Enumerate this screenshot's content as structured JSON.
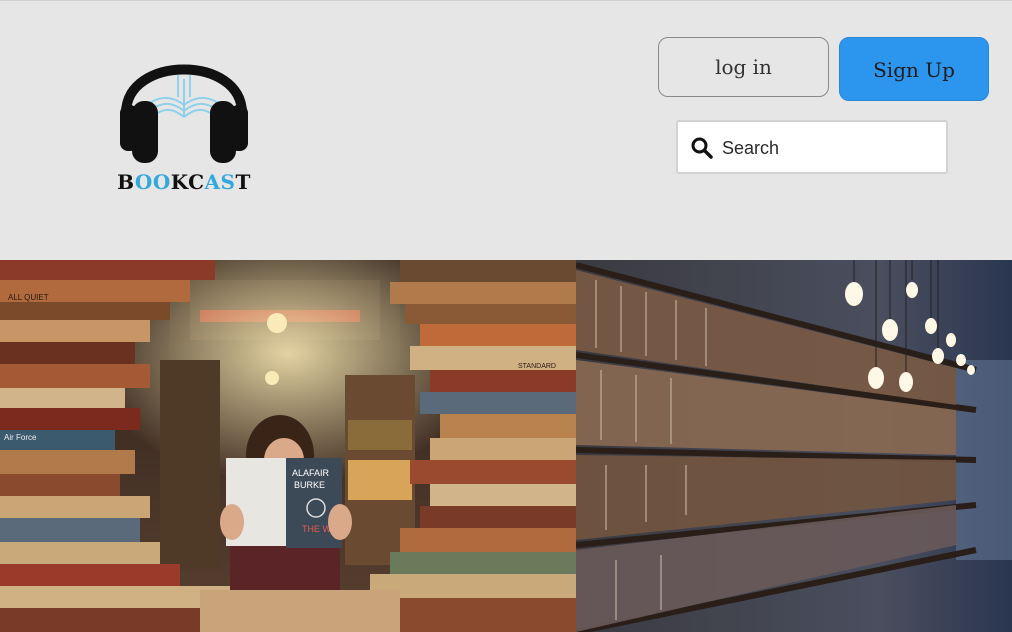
{
  "logo": {
    "text_parts": [
      "B",
      "OO",
      "KC",
      "AS",
      "T"
    ],
    "brand_colors": {
      "dark": "#111111",
      "blue": "#33a8de"
    },
    "icon": "headphones-book-icon"
  },
  "auth": {
    "login_label": "log in",
    "signup_label": "Sign Up"
  },
  "search": {
    "placeholder": "Search",
    "value": "",
    "icon": "search-icon"
  },
  "colors": {
    "header_bg": "#e6e6e6",
    "signup_bg": "#2c96ee"
  },
  "images": {
    "left": "woman-reading-among-book-stacks",
    "right": "library-bookshelves-with-hanging-bulbs"
  }
}
